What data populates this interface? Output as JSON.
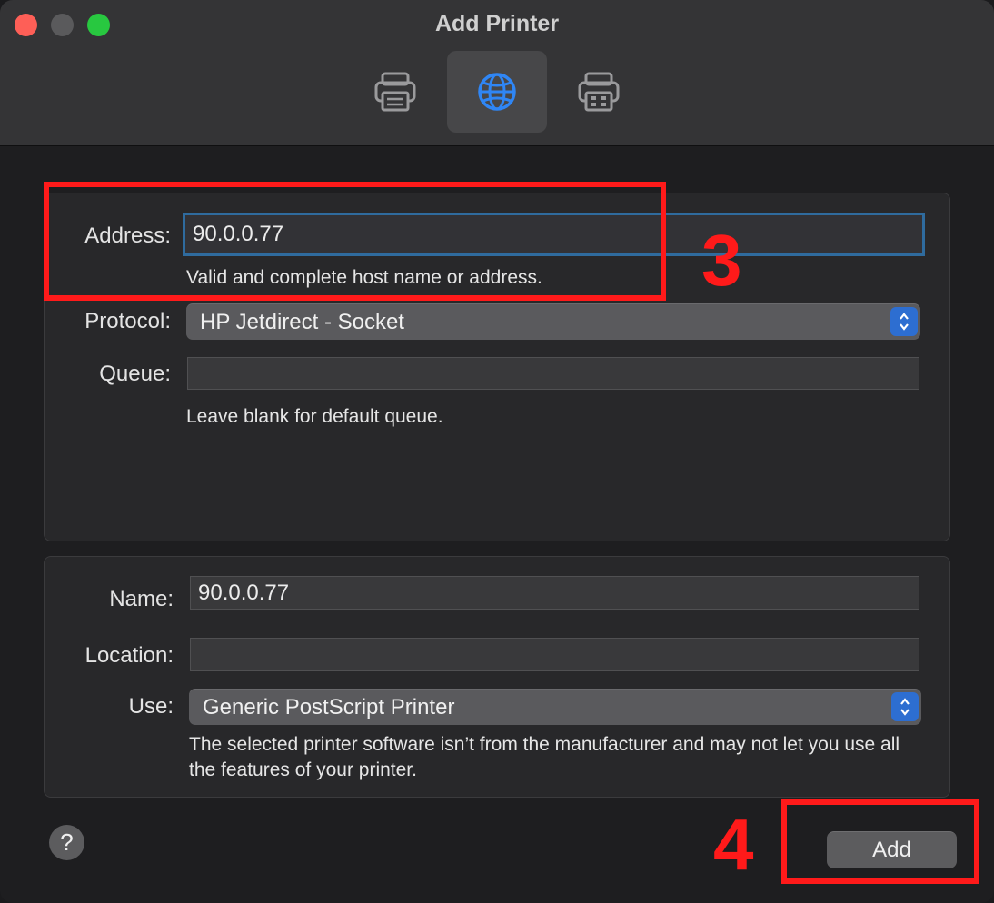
{
  "window": {
    "title": "Add Printer"
  },
  "toolbar": {
    "buttons": [
      {
        "icon": "printer-icon",
        "selected": false
      },
      {
        "icon": "globe-icon",
        "selected": true
      },
      {
        "icon": "windows-printer-icon",
        "selected": false
      }
    ]
  },
  "connection": {
    "address_label": "Address:",
    "address_value": "90.0.0.77",
    "address_help": "Valid and complete host name or address.",
    "protocol_label": "Protocol:",
    "protocol_value": "HP Jetdirect - Socket",
    "queue_label": "Queue:",
    "queue_value": "",
    "queue_help": "Leave blank for default queue."
  },
  "printer": {
    "name_label": "Name:",
    "name_value": "90.0.0.77",
    "location_label": "Location:",
    "location_value": "",
    "use_label": "Use:",
    "use_value": "Generic PostScript Printer",
    "use_help": "The selected printer software isn’t from the manufacturer and may not let you use all the features of your printer."
  },
  "footer": {
    "help_label": "?",
    "add_label": "Add"
  },
  "annotations": {
    "step3": "3",
    "step4": "4"
  },
  "colors": {
    "accent": "#2d6ed1",
    "annotation": "#ff1a1a",
    "focus_ring": "#2f6b9e"
  }
}
